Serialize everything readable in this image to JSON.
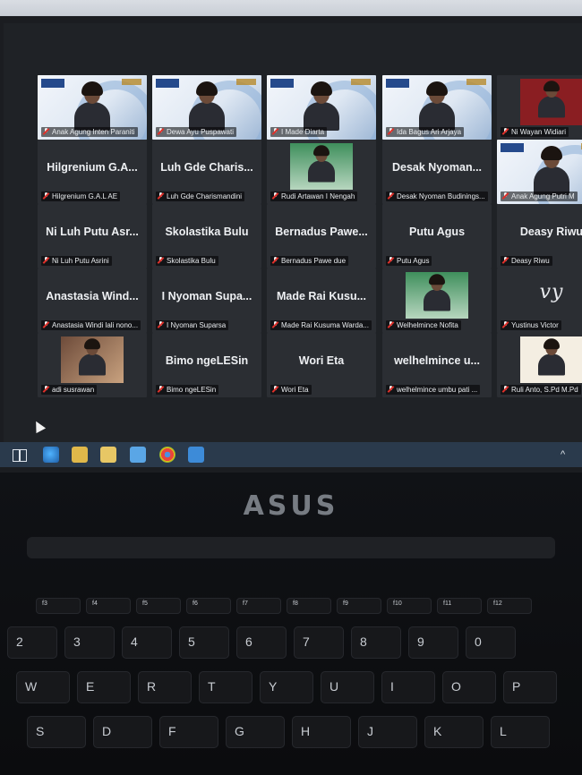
{
  "participants": [
    {
      "row": 0,
      "col": 0,
      "kind": "video",
      "name": "Anak Agung Inten Paraniti",
      "active": true
    },
    {
      "row": 0,
      "col": 1,
      "kind": "video",
      "name": "Dewa Ayu Puspawati"
    },
    {
      "row": 0,
      "col": 2,
      "kind": "video",
      "name": "I Made Diarta"
    },
    {
      "row": 0,
      "col": 3,
      "kind": "video",
      "name": "Ida Bagus Ari Arjaya"
    },
    {
      "row": 0,
      "col": 4,
      "kind": "photo-dark",
      "name": "Ni Wayan Widiari"
    },
    {
      "row": 1,
      "col": 0,
      "kind": "text",
      "display": "Hilgrenium G.A...",
      "name": "Hilgrenium G.A.L AE"
    },
    {
      "row": 1,
      "col": 1,
      "kind": "text",
      "display": "Luh Gde Charis...",
      "name": "Luh Gde Charismandini"
    },
    {
      "row": 1,
      "col": 2,
      "kind": "photo-green",
      "name": "Rudi Artawan I Nengah"
    },
    {
      "row": 1,
      "col": 3,
      "kind": "text",
      "display": "Desak Nyoman...",
      "name": "Desak Nyoman Budinings..."
    },
    {
      "row": 1,
      "col": 4,
      "kind": "video",
      "name": "Anak Agung Putri M"
    },
    {
      "row": 2,
      "col": 0,
      "kind": "text",
      "display": "Ni Luh Putu Asr...",
      "name": "Ni Luh Putu Asrini"
    },
    {
      "row": 2,
      "col": 1,
      "kind": "text",
      "display": "Skolastika Bulu",
      "name": "Skolastika Bulu"
    },
    {
      "row": 2,
      "col": 2,
      "kind": "text",
      "display": "Bernadus Pawe...",
      "name": "Bernadus Pawe due"
    },
    {
      "row": 2,
      "col": 3,
      "kind": "text",
      "display": "Putu Agus",
      "name": "Putu Agus"
    },
    {
      "row": 2,
      "col": 4,
      "kind": "text",
      "display": "Deasy Riwu",
      "name": "Deasy Riwu"
    },
    {
      "row": 3,
      "col": 0,
      "kind": "text",
      "display": "Anastasia Wind...",
      "name": "Anastasia Windi lali nono..."
    },
    {
      "row": 3,
      "col": 1,
      "kind": "text",
      "display": "I Nyoman Supa...",
      "name": "I Nyoman Suparsa"
    },
    {
      "row": 3,
      "col": 2,
      "kind": "text",
      "display": "Made Rai Kusu...",
      "name": "Made Rai Kusuma Warda..."
    },
    {
      "row": 3,
      "col": 3,
      "kind": "photo-green",
      "name": "Welhelmince Nofita"
    },
    {
      "row": 3,
      "col": 4,
      "kind": "logo",
      "display": "vy",
      "name": "Yustinus Victor"
    },
    {
      "row": 4,
      "col": 0,
      "kind": "photo-room",
      "name": "adi susrawan"
    },
    {
      "row": 4,
      "col": 1,
      "kind": "text",
      "display": "Bimo ngeLESin",
      "name": "Bimo ngeLESin"
    },
    {
      "row": 4,
      "col": 2,
      "kind": "text",
      "display": "Wori Eta",
      "name": "Wori Eta"
    },
    {
      "row": 4,
      "col": 3,
      "kind": "text",
      "display": "welhelmince u...",
      "name": "welhelmince umbu pati ..."
    },
    {
      "row": 4,
      "col": 4,
      "kind": "photo-ganesh",
      "name": "Ruli Anto, S.Pd M.Pd"
    }
  ],
  "laptop": {
    "brand": "ASUS"
  },
  "keyboard": {
    "number_row": [
      "2",
      "3",
      "4",
      "5",
      "6",
      "7",
      "8",
      "9",
      "0"
    ],
    "number_row_shift": [
      "@",
      "#",
      "$",
      "%",
      "^",
      "&",
      "*",
      "(",
      ")"
    ],
    "top_row": [
      "W",
      "E",
      "R",
      "T",
      "Y",
      "U",
      "I",
      "O",
      "P"
    ],
    "home_row": [
      "S",
      "D",
      "F",
      "G",
      "H",
      "J",
      "K",
      "L"
    ],
    "fn_row": [
      "f3",
      "f4",
      "f5",
      "f6",
      "f7",
      "f8",
      "f9",
      "f10",
      "f11",
      "f12"
    ]
  }
}
